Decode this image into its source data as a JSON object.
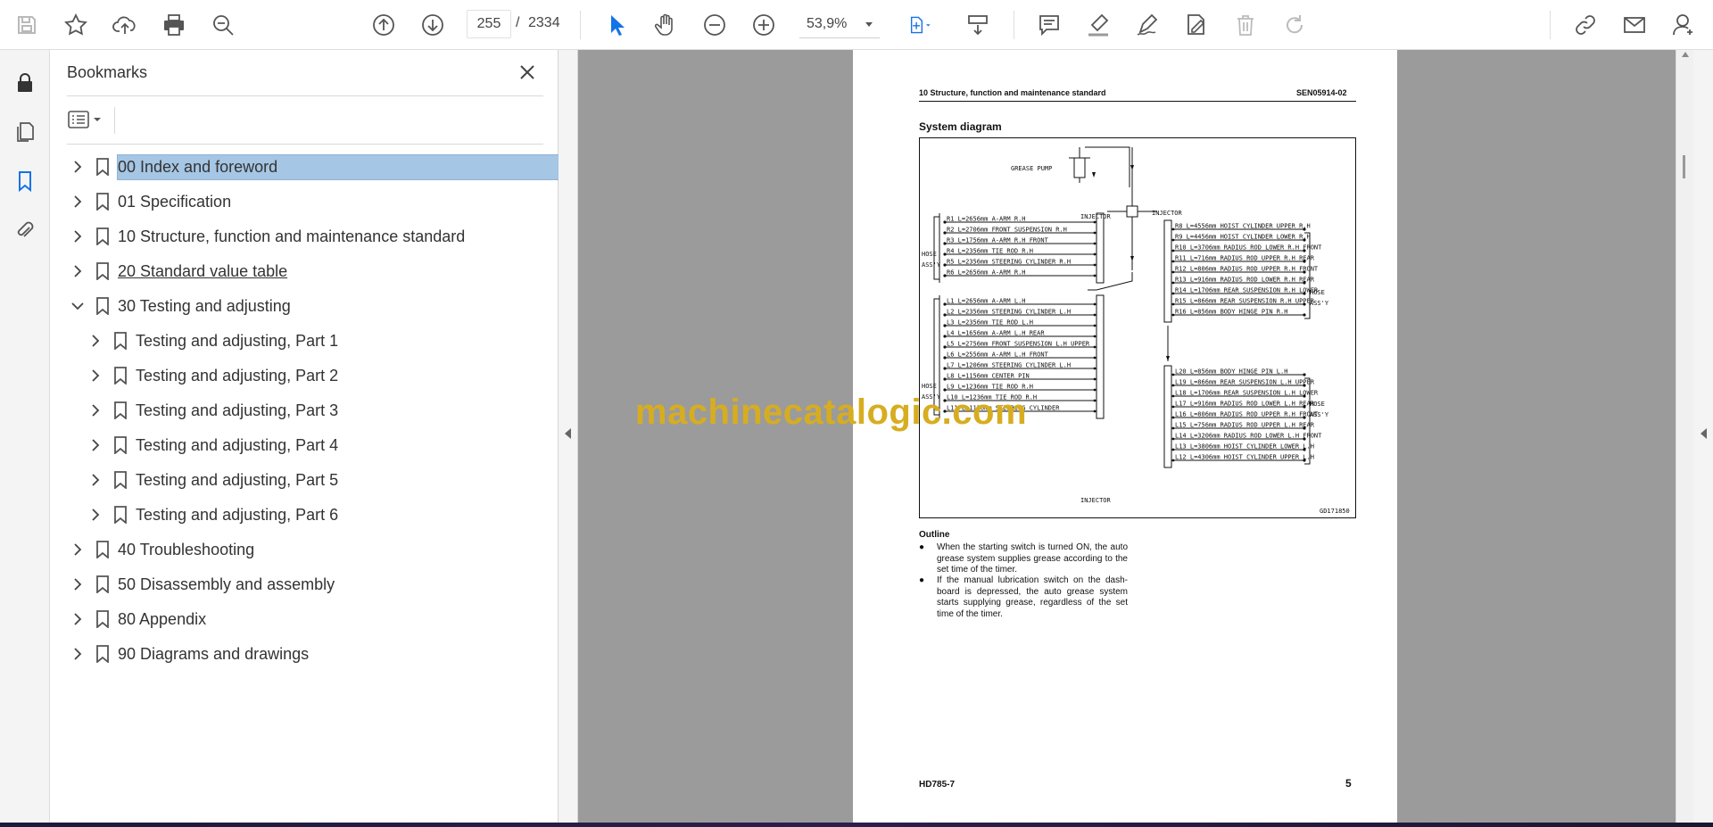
{
  "toolbar": {
    "page_current": "255",
    "page_separator": "/",
    "page_total": "2334",
    "zoom": "53,9%",
    "icons": [
      "save-icon",
      "bookmark-star-icon",
      "upload-cloud-icon",
      "print-icon",
      "find-zoom-icon",
      "prev-page-icon",
      "next-page-icon",
      "select-cursor-icon",
      "hand-icon",
      "zoom-out-icon",
      "zoom-in-icon",
      "fit-page-icon",
      "scroll-mode-icon",
      "comment-icon",
      "highlight-icon",
      "draw-icon",
      "fill-sign-icon",
      "delete-icon",
      "redo-icon",
      "share-link-icon",
      "email-icon",
      "account-icon"
    ]
  },
  "accent": "#1473e6",
  "selection_color": "#a5c6e4",
  "panel": {
    "title": "Bookmarks",
    "bookmarks": [
      {
        "label": "00 Index and foreword",
        "level": 0,
        "expanded": false,
        "selected": true,
        "underline": false
      },
      {
        "label": "01 Specification",
        "level": 0,
        "expanded": false,
        "selected": false,
        "underline": false
      },
      {
        "label": "10 Structure, function and maintenance standard",
        "level": 0,
        "expanded": false,
        "selected": false,
        "underline": false
      },
      {
        "label": "20 Standard value table",
        "level": 0,
        "expanded": false,
        "selected": false,
        "underline": true
      },
      {
        "label": "30 Testing and adjusting",
        "level": 0,
        "expanded": true,
        "selected": false,
        "underline": false
      },
      {
        "label": "Testing and adjusting, Part 1",
        "level": 1,
        "expanded": false,
        "selected": false,
        "underline": false
      },
      {
        "label": "Testing and adjusting, Part 2",
        "level": 1,
        "expanded": false,
        "selected": false,
        "underline": false
      },
      {
        "label": "Testing and adjusting, Part 3",
        "level": 1,
        "expanded": false,
        "selected": false,
        "underline": false
      },
      {
        "label": "Testing and adjusting, Part 4",
        "level": 1,
        "expanded": false,
        "selected": false,
        "underline": false
      },
      {
        "label": "Testing and adjusting, Part 5",
        "level": 1,
        "expanded": false,
        "selected": false,
        "underline": false
      },
      {
        "label": "Testing and adjusting, Part 6",
        "level": 1,
        "expanded": false,
        "selected": false,
        "underline": false
      },
      {
        "label": "40 Troubleshooting",
        "level": 0,
        "expanded": false,
        "selected": false,
        "underline": false
      },
      {
        "label": "50 Disassembly and assembly",
        "level": 0,
        "expanded": false,
        "selected": false,
        "underline": false
      },
      {
        "label": "80 Appendix",
        "level": 0,
        "expanded": false,
        "selected": false,
        "underline": false
      },
      {
        "label": "90 Diagrams and drawings",
        "level": 0,
        "expanded": false,
        "selected": false,
        "underline": false
      }
    ]
  },
  "document": {
    "header_left": "10 Structure, function and maintenance standard",
    "header_right": "SEN05914-02",
    "section_title": "System diagram",
    "diagram": {
      "pump_label": "GREASE PUMP",
      "injector_label": "INJECTOR",
      "hose_label": "HOSE",
      "assy_label": "ASS'Y",
      "code": "GD171850",
      "left_upper": [
        "R1 L=2656mm A-ARM R.H",
        "R2 L=2706mm FRONT SUSPENSION R.H",
        "R3 L=1756mm A-ARM R.H FRONT",
        "R4 L=2356mm TIE ROD R.H",
        "R5 L=2356mm STEERING CYLINDER R.H",
        "R6 L=2656mm A-ARM R.H"
      ],
      "left_lower": [
        "L1 L=2656mm A-ARM L.H",
        "L2 L=2356mm STEERING CYLINDER L.H",
        "L3 L=2356mm TIE ROD L.H",
        "L4 L=1656mm A-ARM L.H REAR",
        "L5 L=2756mm FRONT SUSPENSION L.H UPPER",
        "L6 L=2556mm A-ARM L.H FRONT",
        "L7 L=1206mm STEERING CYLINDER L.H",
        "L8 L=1156mm CENTER PIN",
        "L9 L=1236mm TIE ROD R.H",
        "L10 L=1236mm TIE ROD R.H",
        "L11 L=1156mm STEERING CYLINDER"
      ],
      "right_upper": [
        "R8 L=4556mm HOIST CYLINDER UPPER R.H",
        "R9 L=4456mm HOIST CYLINDER LOWER R.H",
        "R10 L=3706mm RADIUS ROD LOWER R.H FRONT",
        "R11 L=716mm RADIUS ROD UPPER R.H REAR",
        "R12 L=806mm RADIUS ROD UPPER R.H FRONT",
        "R13 L=916mm RADIUS ROD LOWER R.H REAR",
        "R14 L=1706mm REAR SUSPENSION R.H LOWER",
        "R15 L=866mm REAR SUSPENSION R.H UPPER",
        "R16 L=856mm BODY HINGE PIN R.H"
      ],
      "right_lower": [
        "L20 L=856mm BODY HINGE PIN L.H",
        "L19 L=866mm REAR SUSPENSION L.H UPPER",
        "L18 L=1706mm REAR SUSPENSION L.H LOWER",
        "L17 L=916mm RADIUS ROD LOWER L.H REAR",
        "L16 L=806mm RADIUS ROD UPPER R.H FRONT",
        "L15 L=756mm RADIUS ROD UPPER L.H REAR",
        "L14 L=3206mm RADIUS ROD LOWER L.H FRONT",
        "L13 L=3806mm HOIST CYLINDER LOWER L.H",
        "L12 L=4306mm HOIST CYLINDER UPPER L.H"
      ]
    },
    "outline_title": "Outline",
    "bullets": [
      "When the starting switch is turned ON, the auto grease system supplies grease according to the set time of the timer.",
      "If the manual lubrication switch on the dash-board is depressed, the auto grease system starts supplying grease, regardless of the set time of the timer."
    ],
    "footer_left": "HD785-7",
    "footer_right": "5"
  },
  "watermark": "machinecatalogic.com"
}
